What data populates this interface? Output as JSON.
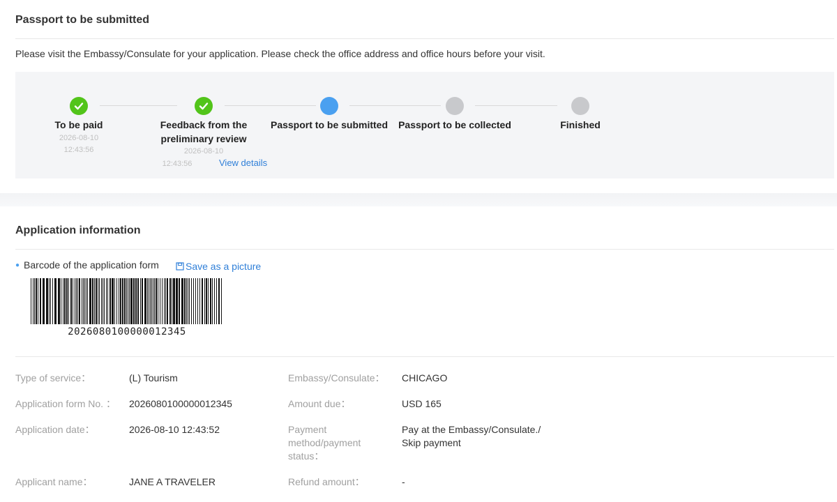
{
  "top": {
    "title": "Passport to be submitted",
    "notice": "Please visit the Embassy/Consulate for your application. Please check the office address and office hours before your visit.",
    "steps": [
      {
        "label": "To be paid",
        "status": "done",
        "date": "2026-08-10",
        "time": "12:43:56"
      },
      {
        "label_line1": "Feedback from the",
        "label_line2": "preliminary review",
        "status": "done",
        "date": "2026-08-10",
        "time": "12:43:56",
        "link": "View details"
      },
      {
        "label": "Passport to be submitted",
        "status": "current"
      },
      {
        "label": "Passport to be collected",
        "status": "pending"
      },
      {
        "label": "Finished",
        "status": "pending"
      }
    ],
    "colors": {
      "done": "#52c41a",
      "current": "#4aa0f0",
      "pending": "#c8c9cc",
      "link": "#2f7fd8"
    }
  },
  "info": {
    "title": "Application information",
    "barcode_label": "Barcode of the application form",
    "save_label": "Save as a picture",
    "barcode_number": "2026080100000012345",
    "fields": {
      "type_label": "Type of service：",
      "type_value": "(L) Tourism",
      "embassy_label": "Embassy/Consulate：",
      "embassy_value": "CHICAGO",
      "form_no_label": "Application form No. ：",
      "form_no_value": "2026080100000012345",
      "amount_label": "Amount due：",
      "amount_value": "USD 165",
      "date_label": "Application date：",
      "date_value": "2026-08-10 12:43:52",
      "payment_label_1": "Payment",
      "payment_label_2": "method/payment",
      "payment_label_3": "status：",
      "payment_value_1": "Pay at the Embassy/Consulate./",
      "payment_value_2": "Skip payment",
      "applicant_label": "Applicant name：",
      "applicant_value": "JANE A TRAVELER",
      "refund_label": "Refund amount：",
      "refund_value": "-"
    }
  }
}
